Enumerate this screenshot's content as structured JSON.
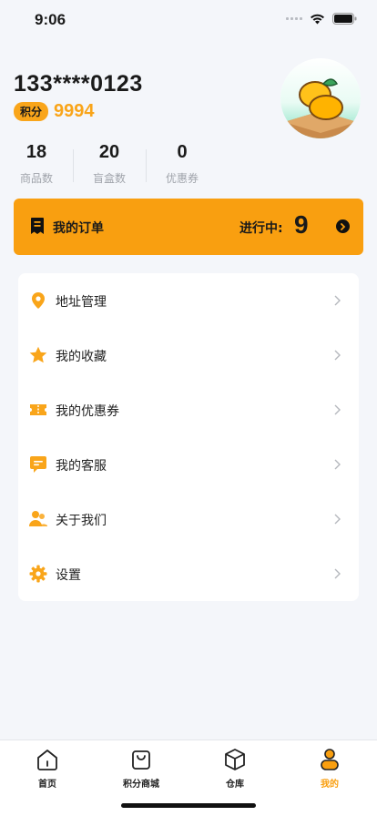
{
  "status_bar": {
    "time": "9:06"
  },
  "profile": {
    "username": "133****0123",
    "points_badge": "积分",
    "points_value": "9994"
  },
  "stats": [
    {
      "value": "18",
      "label": "商品数"
    },
    {
      "value": "20",
      "label": "盲盒数"
    },
    {
      "value": "0",
      "label": "优惠券"
    }
  ],
  "order": {
    "title": "我的订单",
    "progress_label": "进行中:",
    "progress_count": "9"
  },
  "menu": [
    {
      "label": "地址管理",
      "icon": "location-pin-icon"
    },
    {
      "label": "我的收藏",
      "icon": "star-icon"
    },
    {
      "label": "我的优惠券",
      "icon": "ticket-icon"
    },
    {
      "label": "我的客服",
      "icon": "chat-icon"
    },
    {
      "label": "关于我们",
      "icon": "users-icon"
    },
    {
      "label": "设置",
      "icon": "gear-icon"
    }
  ],
  "tabbar": [
    {
      "label": "首页",
      "icon": "home-icon",
      "active": false
    },
    {
      "label": "积分商城",
      "icon": "shopping-bag-icon",
      "active": false
    },
    {
      "label": "仓库",
      "icon": "box-icon",
      "active": false
    },
    {
      "label": "我的",
      "icon": "person-icon",
      "active": true
    }
  ],
  "colors": {
    "accent": "#f99f10",
    "background": "#f4f6fa",
    "muted_text": "#a0a4ab"
  }
}
